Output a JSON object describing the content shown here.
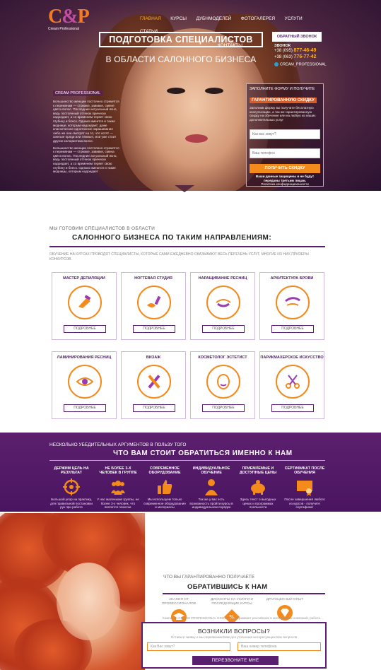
{
  "logo": {
    "mark_c": "C",
    "mark_amp": "&",
    "mark_p": "P",
    "subtitle": "Cream Professional"
  },
  "nav": {
    "items": [
      "ГЛАВНАЯ",
      "КУРСЫ",
      "ДУБНМОДЕЛЕЙ",
      "ФОТОГАЛЕРЕЯ",
      "УСЛУГИ",
      "СТАТЬИ"
    ],
    "row2": "КОНТАКТЫ"
  },
  "hero": {
    "title": "ПОДГОТОВКА СПЕЦИАЛИСТОВ",
    "subtitle": "В ОБЛАСТИ САЛОННОГО БИЗНЕСА",
    "tag": "CREAM PROFESSIONAL",
    "text1": "Большинство женщин постоянно стремятся к перемянам — стрижке, завивке, смене цвета волос. Последние актуальный ясно, ведь постоянный оттенок прически надоедает, а со временем теряет свою глубину и блеск. Однако имеется и такие моднице, которым надоедает; даже классическое однотонное окрашивание либо же они смотрят на то, что хотят — смелые пряди или темные, или уже стоит другие колористика волос.",
    "text2": "Большинство женщин постоянно стремятся к перемянам — стрижке, завивке, смена цвета волос. Последние актуальный ясно, ведь постоянный оттенок прически надоедает, а со временем теряет свою глубину и блеск. Однако имеются и такие модницы, которым надоедает"
  },
  "contacts": {
    "callback": "ОБРАТНЫЙ ЗВОНОК",
    "phone_label": "ЗВОНОК",
    "phone1_code": "+38 (095)",
    "phone1_num": "877-46-49",
    "phone2_code": "+38 (063)",
    "phone2_num": "776-77-42",
    "insta": "CREAM_PROFESSIONAL"
  },
  "form": {
    "line1": "ЗАПОЛНИТЕ ФОРМУ И ПОЛУЧИТЕ",
    "highlight": "ГАРАНТИРОВАННУЮ СКИДКУ",
    "desc": "Заполнив форму вы получите бесплатную консультацию, а так же гарантированную скидку на обучение или на любую из наших дополнительных услуг",
    "name_placeholder": "Как вас зовут?",
    "phone_placeholder": "Ваш телефон",
    "button": "ПОЛУЧИТЬ СКИДКУ",
    "note": "Ваши данные защищены и не будут переданы третьим лицам.",
    "policy": "Политика конфиденциальности"
  },
  "directions": {
    "subtitle": "МЫ ГОТОВИМ СПЕЦИАЛИСТОВ В ОБЛАСТИ",
    "title": "САЛОННОГО БИЗНЕСА ПО ТАКИМ НАПРАВЛЕНИЯМ:",
    "desc": "ОБУЧЕНИЕ НА КУРСАХ ПРОВОДЯТ СПЕЦИАЛИСТЫ, КОТОРЫЕ САМИ ЕЖЕДНЕВНО ОКАЗЫВАЮТ ВЕСЬ ПЕРЕЧЕНЬ УСЛУГ, МНОГИЕ ИЗ НИХ ПРИЗЕРЫ КОНКУРСОВ.",
    "more": "ПОДРОБНЕЕ",
    "cards": [
      {
        "title": "МАСТЕР ДЕПИЛЯЦИИ"
      },
      {
        "title": "НОГТЕВАЯ СТУДИЯ"
      },
      {
        "title": "НАРАЩИВАНИЕ РЕСНИЦ"
      },
      {
        "title": "АРХИТЕКТУРА БРОВИ"
      },
      {
        "title": "ЛАМИНИРОВАНИЯ РЕСНИЦ"
      },
      {
        "title": "ВИЗАЖ"
      },
      {
        "title": "КОСМЕТОЛОГ ЭСТЕТИСТ"
      },
      {
        "title": "ПАРИКМАХЕРСКОЕ ИСКУССТВО"
      }
    ]
  },
  "arguments": {
    "subtitle": "НЕСКОЛЬКО УБЕДИТЕЛЬНЫХ АРГУМЕНТОВ В ПОЛЬЗУ ТОГО",
    "title": "ЧТО ВАМ СТОИТ ОБРАТИТЬСЯ ИМЕННО К НАМ",
    "items": [
      {
        "title": "ДЕРЖИМ ЦЕЛЬ НА РЕЗУЛЬТАТ",
        "icon": "target-icon",
        "desc": "Большой упор на практику, для правильной постановки рук при работе"
      },
      {
        "title": "НЕ БОЛЕЕ 3-Х ЧЕЛОВЕК В ГРУППЕ",
        "icon": "group-icon",
        "desc": "У нас маленькие группы, не более 3-х человек, что является плюсом."
      },
      {
        "title": "СОВРЕМЕННОЕ ОБОРУДОВАНИЕ",
        "icon": "thumbs-up-icon",
        "desc": "Мы используем только современное оборудование и материалы"
      },
      {
        "title": "ИНДИВИДУАЛЬНОЕ ОБУЧЕНИЕ",
        "icon": "person-icon",
        "desc": "Так же у вас есть возможность пройти курсы в индивидуальном порядке"
      },
      {
        "title": "ПРИЕМЛЕМЫЕ И ДОСТУПНЫЕ ЦЕНЫ",
        "icon": "piggy-bank-icon",
        "desc": "Здесь текст о выгодных ценах и программах лояльности"
      },
      {
        "title": "СЕРТИФИКАТ ПОСЛЕ ОБУЧЕНИЯ",
        "icon": "certificate-icon",
        "desc": "После завершения любого из курсов - получите сертификат"
      }
    ]
  },
  "guarantee": {
    "subtitle": "ЧТО ВЫ ГАРАНТИРОВАННО ПОЛУЧАЕТЕ",
    "title": "ОБРАТИВШИСЬ К НАМ",
    "items": [
      {
        "label": "ЗНАНИЯ ОТ ПРОФЕССИОНАЛОВ",
        "icon": "graduation-cap-icon"
      },
      {
        "label": "ДИСКОНТЫ НА УСЛУГИ И ПОСЛЕДУЮЩИЕ КУРСЫ",
        "icon": "percent-icon"
      },
      {
        "label": "ДРАГОЦЕННЫЙ ОПЫТ",
        "icon": "diamond-icon"
      }
    ],
    "desc": "Компания CREAM PROFESSIONAL GROUP поддерживает российских и иностранных компаний, работающих на отечественном рынке для реализации их динамичного роста, защиты своих интересов, управления текущей деятельностью. Помогает создавать системы внутреннего контроля; устанавливает взаимовыгодные отношения с партнерами в регионах, организуя сотрудничество с ведущими компаниями."
  },
  "questions": {
    "title": "ВОЗНИКЛИ ВОПРОСЫ?",
    "text": "Оставьте заявку и мы перезвоним Вам для уточнения интересующих Вас вопросов",
    "name_placeholder": "Как Вас зовут?",
    "phone_placeholder": "Ваш номер телефона",
    "button": "ПЕРЕЗВОНИТЕ МНЕ"
  },
  "colors": {
    "accent": "#f28a1c",
    "brand": "#5a2070"
  }
}
